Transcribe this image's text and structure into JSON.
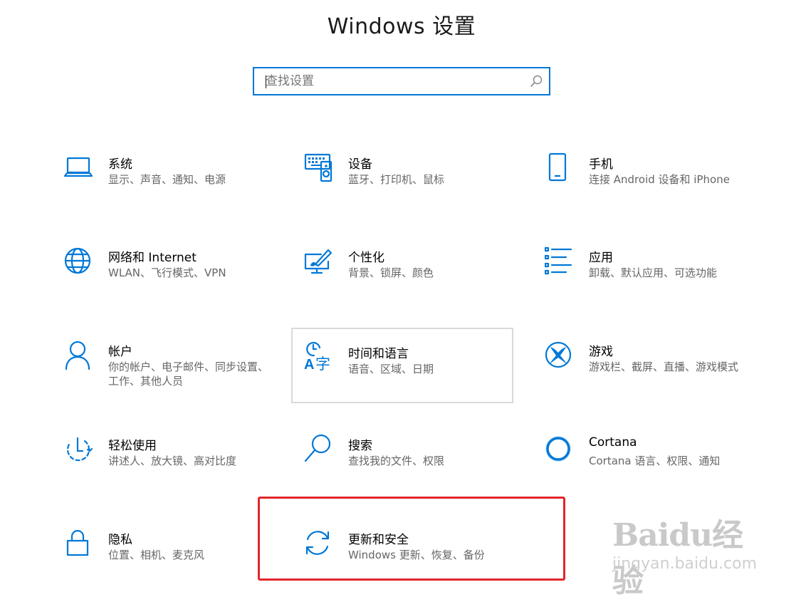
{
  "window": {
    "title": "Windows 设置"
  },
  "search": {
    "placeholder": "查找设置"
  },
  "tiles": [
    {
      "icon": "laptop-icon",
      "name": "系统",
      "desc": "显示、声音、通知、电源"
    },
    {
      "icon": "keyboard-speaker-icon",
      "name": "设备",
      "desc": "蓝牙、打印机、鼠标"
    },
    {
      "icon": "phone-icon",
      "name": "手机",
      "desc": "连接 Android 设备和 iPhone"
    },
    {
      "icon": "globe-icon",
      "name": "网络和 Internet",
      "desc": "WLAN、飞行模式、VPN"
    },
    {
      "icon": "paint-monitor-icon",
      "name": "个性化",
      "desc": "背景、锁屏、颜色"
    },
    {
      "icon": "apps-list-icon",
      "name": "应用",
      "desc": "卸载、默认应用、可选功能"
    },
    {
      "icon": "person-icon",
      "name": "帐户",
      "desc": "你的帐户、电子邮件、同步设置、工作、其他人员"
    },
    {
      "icon": "clock-language-icon",
      "name": "时间和语言",
      "desc": "语音、区域、日期"
    },
    {
      "icon": "xbox-icon",
      "name": "游戏",
      "desc": "游戏栏、截屏、直播、游戏模式"
    },
    {
      "icon": "ease-of-access-icon",
      "name": "轻松使用",
      "desc": "讲述人、放大镜、高对比度"
    },
    {
      "icon": "search-magnifier-icon",
      "name": "搜索",
      "desc": "查找我的文件、权限"
    },
    {
      "icon": "cortana-icon",
      "name": "Cortana",
      "desc": "Cortana 语言、权限、通知"
    },
    {
      "icon": "lock-icon",
      "name": "隐私",
      "desc": "位置、相机、麦克风"
    },
    {
      "icon": "sync-icon",
      "name": "更新和安全",
      "desc": "Windows 更新、恢复、备份"
    }
  ],
  "watermark": {
    "logo": "Baidu经验",
    "url": "jingyan.baidu.com"
  },
  "colors": {
    "accent": "#0078d7",
    "highlight_box": "#e3262b",
    "hover_border": "#d9d9d9"
  }
}
